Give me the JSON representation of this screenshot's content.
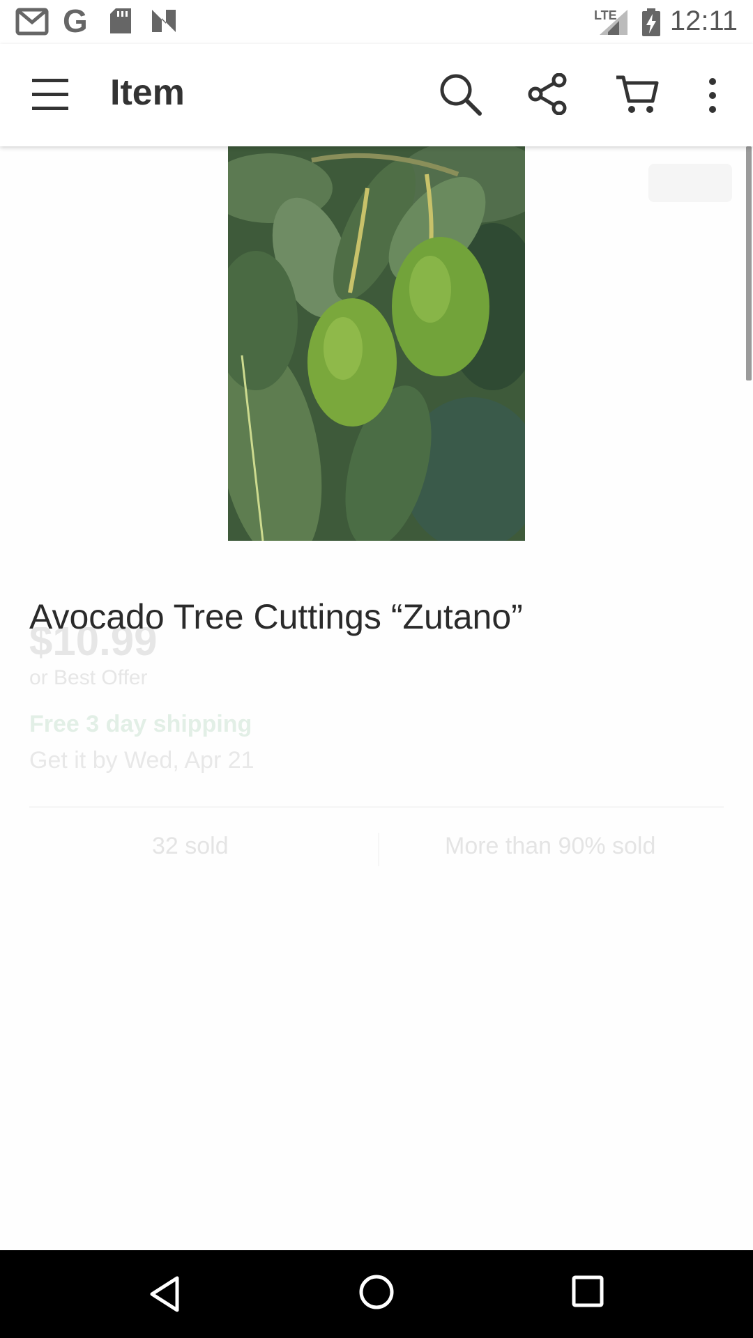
{
  "status_bar": {
    "time": "12:11",
    "network": "LTE",
    "notification_icons": [
      "gmail-icon",
      "google-icon",
      "sd-card-icon",
      "n-app-icon"
    ],
    "system_icons": [
      "signal-icon",
      "battery-charging-icon"
    ]
  },
  "app_bar": {
    "title": "Item",
    "icons": [
      "menu-icon",
      "search-icon",
      "share-icon",
      "cart-icon",
      "more-vert-icon"
    ]
  },
  "product": {
    "image_alt": "avocado-photo",
    "title": "Avocado Tree Cuttings “Zutano”",
    "price": "$10.99",
    "best_offer": "or Best Offer",
    "shipping": "Free 3 day shipping",
    "arrival": "Get it by Wed, Apr 21"
  },
  "stats": {
    "sold_count": "32 sold",
    "sold_percent": "More than 90% sold"
  },
  "colors": {
    "app_bar_bg": "#ffffff",
    "nav_bar_bg": "#000000",
    "title_text": "#2a2a2a"
  },
  "nav_bar": {
    "icons": [
      "back-icon",
      "home-icon",
      "recents-icon"
    ]
  }
}
